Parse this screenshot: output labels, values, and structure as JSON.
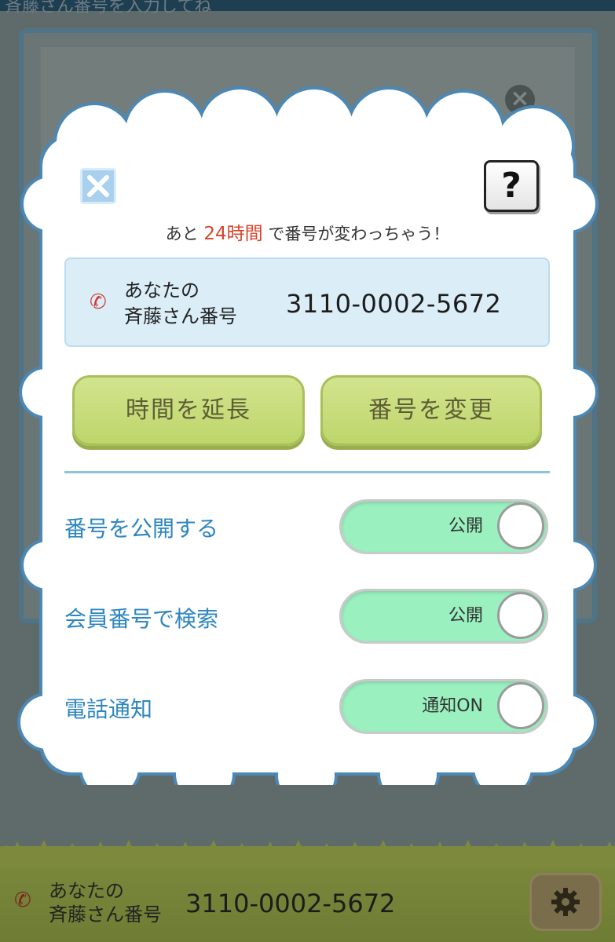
{
  "background": {
    "title_fragment": "斉藤さん番号を入力してね",
    "bottom_bar": {
      "label_line1": "あなたの",
      "label_line2": "斉藤さん番号",
      "number": "3110-0002-5672"
    }
  },
  "dialog": {
    "notice": {
      "prefix": "あと",
      "hours": "24時間",
      "suffix": "で番号が変わっちゃう！"
    },
    "help_label": "?",
    "number_card": {
      "label_line1": "あなたの",
      "label_line2": "斉藤さん番号",
      "number": "3110-0002-5672"
    },
    "buttons": {
      "extend": "時間を延長",
      "change": "番号を変更"
    },
    "settings": [
      {
        "label": "番号を公開する",
        "toggle": "公開"
      },
      {
        "label": "会員番号で検索",
        "toggle": "公開"
      },
      {
        "label": "電話通知",
        "toggle": "通知ON"
      }
    ]
  },
  "colors": {
    "accent_red": "#d9442c",
    "setting_blue": "#2e86bf",
    "toggle_on": "#9af0bf",
    "button_green": "#c8dd7c"
  }
}
